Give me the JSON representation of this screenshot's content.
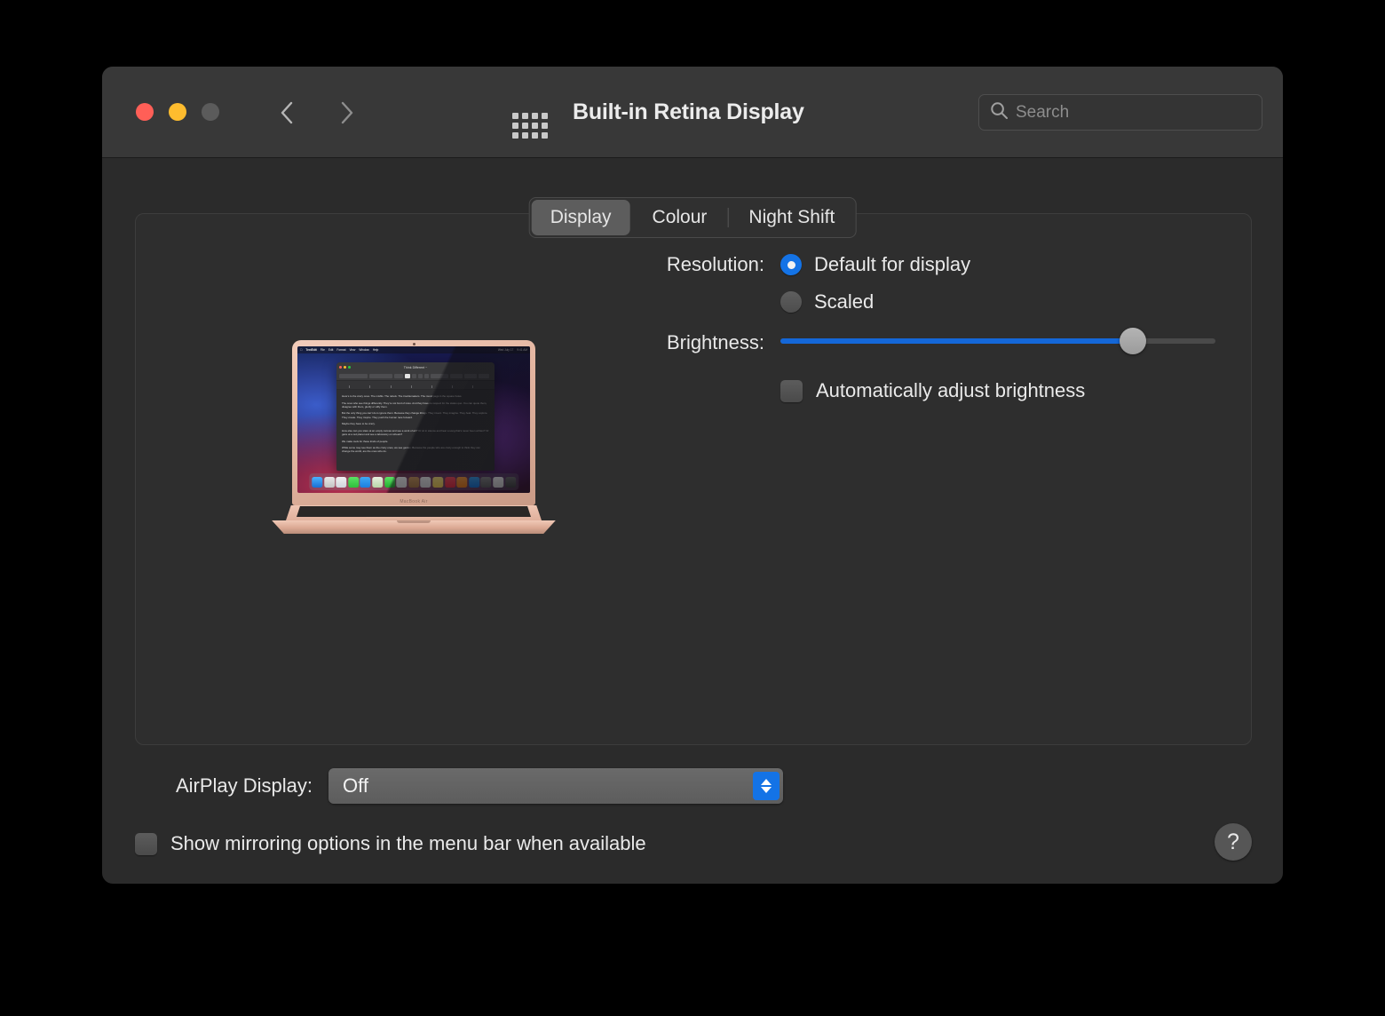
{
  "window": {
    "title": "Built-in Retina Display",
    "traffic_lights": {
      "close": "close",
      "minimize": "minimize",
      "zoom": "zoom"
    },
    "nav": {
      "back": "back",
      "forward": "forward"
    },
    "grid_button": "show-all-preferences",
    "search": {
      "placeholder": "Search",
      "value": "",
      "icon": "search-icon"
    }
  },
  "tabs": [
    {
      "label": "Display",
      "active": true
    },
    {
      "label": "Colour",
      "active": false
    },
    {
      "label": "Night Shift",
      "active": false
    }
  ],
  "preview": {
    "device_label": "MacBook Air",
    "menubar": {
      "apple": "",
      "items": [
        "TextEdit",
        "File",
        "Edit",
        "Format",
        "View",
        "Window",
        "Help"
      ],
      "right": [
        "",
        "",
        "Wed July 17",
        "9:41 AM"
      ]
    },
    "textedit": {
      "title": "Think Different ~",
      "font_name": "Helvetica",
      "font_style": "Regular",
      "font_size": "12",
      "line_spacing": "1.0",
      "paragraphs": [
        "Here's to the crazy ones. The misfits. The rebels. The troublemakers. The round pegs in the square holes.",
        "The ones who see things differently. They're not fond of rules. And they have no respect for the status quo. You can quote them, disagree with them, glorify or vilify them.",
        "But the only thing you can't do is ignore them. Because they change things. They invent. They imagine. They heal. They explore. They create. They inspire. They push the human race forward.",
        "Maybe they have to be crazy.",
        "How else can you stare at an empty canvas and see a work of art? Or sit in silence and hear a song that's never been written? Or gaze at a red planet and see a laboratory on wheels?",
        "We make tools for these kinds of people.",
        "While some may see them as the crazy ones, we see genius. Because the people who are crazy enough to think they can change the world, are the ones who do."
      ]
    },
    "dock_icons": [
      "finder-icon",
      "launchpad-icon",
      "safari-icon",
      "messages-icon",
      "mail-icon",
      "maps-icon",
      "facetime-icon",
      "calendar-icon",
      "contacts-icon",
      "reminders-icon",
      "notes-icon",
      "music-icon",
      "books-icon",
      "appstore-icon",
      "systemprefs-icon",
      "textedit-icon",
      "trash-icon"
    ]
  },
  "controls": {
    "resolution": {
      "label": "Resolution:",
      "options": [
        {
          "label": "Default for display",
          "selected": true
        },
        {
          "label": "Scaled",
          "selected": false
        }
      ]
    },
    "brightness": {
      "label": "Brightness:",
      "value_percent": 81,
      "min": 0,
      "max": 100
    },
    "auto_brightness": {
      "label": "Automatically adjust brightness",
      "checked": false
    }
  },
  "airplay": {
    "label": "AirPlay Display:",
    "value": "Off",
    "options": [
      "Off"
    ]
  },
  "mirroring": {
    "label": "Show mirroring options in the menu bar when available",
    "checked": false
  },
  "help": {
    "label": "?"
  },
  "colors": {
    "accent_blue": "#1473e6",
    "slider_blue": "#1467d8",
    "window_bg": "#2b2b2b",
    "titlebar_bg": "#383838",
    "panel_bg": "#2e2e2e",
    "close_red": "#ff5f57",
    "minimize_yellow": "#febc2e",
    "zoom_grey": "#5b5b5b",
    "text_primary": "#eaeaea",
    "text_secondary": "#8d8d8d"
  }
}
